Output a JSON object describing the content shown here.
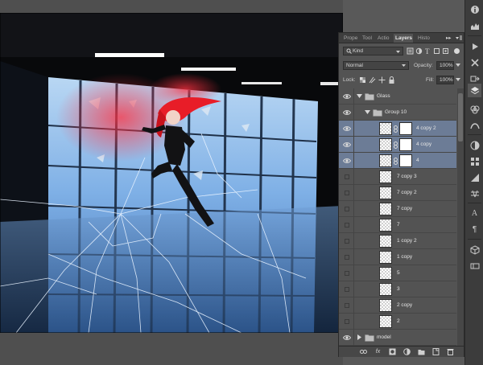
{
  "panel": {
    "tabs": [
      {
        "label": "Prope",
        "active": false
      },
      {
        "label": "Tool",
        "active": false
      },
      {
        "label": "Actio",
        "active": false
      },
      {
        "label": "Layers",
        "active": true
      },
      {
        "label": "Histo",
        "active": false
      }
    ],
    "tab_menu_label": "▸▸",
    "filter": {
      "kind_label": "Kind"
    },
    "blend_mode": "Normal",
    "opacity_label": "Opacity:",
    "opacity_value": "100%",
    "lock_label": "Lock:",
    "fill_label": "Fill:",
    "fill_value": "100%"
  },
  "layers": [
    {
      "name": "Glass",
      "type": "group",
      "indent": 0,
      "visible": true,
      "expanded": true,
      "selected": false
    },
    {
      "name": "Group 10",
      "type": "group",
      "indent": 1,
      "visible": true,
      "expanded": true,
      "selected": false
    },
    {
      "name": "4 copy 2",
      "type": "masked",
      "indent": 2,
      "visible": true,
      "selected": true
    },
    {
      "name": "4 copy",
      "type": "masked",
      "indent": 2,
      "visible": true,
      "selected": true
    },
    {
      "name": "4",
      "type": "masked",
      "indent": 2,
      "visible": true,
      "selected": true
    },
    {
      "name": "7 copy 3",
      "type": "layer",
      "indent": 2,
      "visible": false,
      "selected": false
    },
    {
      "name": "7 copy 2",
      "type": "layer",
      "indent": 2,
      "visible": false,
      "selected": false
    },
    {
      "name": "7 copy",
      "type": "layer",
      "indent": 2,
      "visible": false,
      "selected": false
    },
    {
      "name": "7",
      "type": "layer",
      "indent": 2,
      "visible": false,
      "selected": false
    },
    {
      "name": "1 copy 2",
      "type": "layer",
      "indent": 2,
      "visible": false,
      "selected": false
    },
    {
      "name": "1 copy",
      "type": "layer",
      "indent": 2,
      "visible": false,
      "selected": false
    },
    {
      "name": "5",
      "type": "layer",
      "indent": 2,
      "visible": false,
      "selected": false
    },
    {
      "name": "3",
      "type": "layer",
      "indent": 2,
      "visible": false,
      "selected": false
    },
    {
      "name": "2 copy",
      "type": "layer",
      "indent": 2,
      "visible": false,
      "selected": false
    },
    {
      "name": "2",
      "type": "layer",
      "indent": 2,
      "visible": false,
      "selected": false
    },
    {
      "name": "model",
      "type": "group",
      "indent": 0,
      "visible": true,
      "expanded": false,
      "selected": false
    }
  ],
  "footer_icons": [
    "link-icon",
    "fx-icon",
    "mask-icon",
    "adjustment-icon",
    "new-group-icon",
    "new-layer-icon",
    "trash-icon"
  ],
  "footer_fx_label": "fx",
  "tools": [
    "info-icon",
    "histogram-icon",
    "play-icon",
    "brush-preset-icon",
    "clone-source-icon",
    "layers-icon",
    "channels-icon",
    "paths-icon",
    "adjustments-icon",
    "swatches-icon",
    "color-icon",
    "styles-icon",
    "character-icon",
    "paragraph-icon",
    "3d-icon",
    "timeline-icon"
  ],
  "tools_text": {
    "character": "A",
    "paragraph": "¶"
  },
  "colors": {
    "panel_bg": "#535353",
    "selected_row": "#6c7c96",
    "tab_bar": "#3e3e3e",
    "canvas_bg": "#0a0a0c",
    "sky": "#86b3e6"
  }
}
